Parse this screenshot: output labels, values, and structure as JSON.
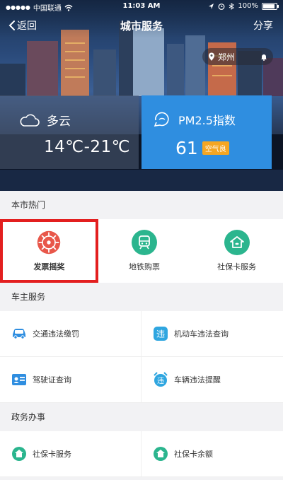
{
  "statusbar": {
    "carrier": "中国联通",
    "time": "11:03 AM",
    "battery": "100%"
  },
  "navbar": {
    "back_label": "返回",
    "title": "城市服务",
    "share_label": "分享"
  },
  "location": {
    "city": "郑州"
  },
  "weather": {
    "condition": "多云",
    "temperature": "14℃-21℃"
  },
  "air": {
    "label": "PM2.5指数",
    "value": "61",
    "quality": "空气良"
  },
  "hot": {
    "heading": "本市热门",
    "items": [
      {
        "label": "发票摇奖",
        "icon": "invoice-lottery-icon",
        "color": "#e8574a"
      },
      {
        "label": "地铁购票",
        "icon": "metro-ticket-icon",
        "color": "#2bb58e"
      },
      {
        "label": "社保卡服务",
        "icon": "social-security-icon",
        "color": "#2bb58e"
      }
    ]
  },
  "car": {
    "heading": "车主服务",
    "items": [
      {
        "label": "交通违法缴罚",
        "icon": "car-icon",
        "color": "#2f8ee0"
      },
      {
        "label": "机动车违法查询",
        "icon": "violation-icon",
        "color": "#2fa6e0"
      },
      {
        "label": "驾驶证查询",
        "icon": "license-card-icon",
        "color": "#2f8ee0"
      },
      {
        "label": "车辆违法提醒",
        "icon": "alarm-violation-icon",
        "color": "#2fa6e0"
      }
    ]
  },
  "gov": {
    "heading": "政务办事",
    "items": [
      {
        "label": "社保卡服务",
        "icon": "social-security-icon",
        "color": "#2bb58e"
      },
      {
        "label": "社保卡余额",
        "icon": "social-balance-icon",
        "color": "#2bb58e"
      }
    ]
  }
}
